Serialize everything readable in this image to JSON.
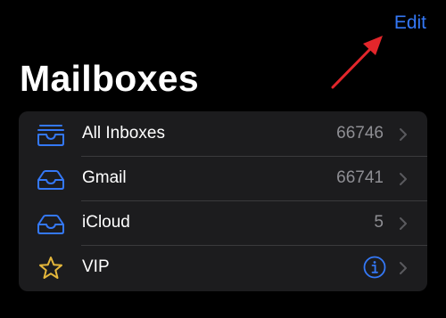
{
  "header": {
    "edit_label": "Edit",
    "title": "Mailboxes"
  },
  "colors": {
    "accent": "#3478f6",
    "vip_star": "#e5b73b",
    "annotation_arrow": "#e3262b",
    "list_background": "#1c1c1e",
    "secondary_text": "#8e8e93"
  },
  "mailboxes": [
    {
      "label": "All Inboxes",
      "count": "66746",
      "icon": "inbox-stack-icon"
    },
    {
      "label": "Gmail",
      "count": "66741",
      "icon": "inbox-icon"
    },
    {
      "label": "iCloud",
      "count": "5",
      "icon": "inbox-icon"
    },
    {
      "label": "VIP",
      "count": "",
      "icon": "star-icon",
      "accessory": "info-icon"
    }
  ]
}
